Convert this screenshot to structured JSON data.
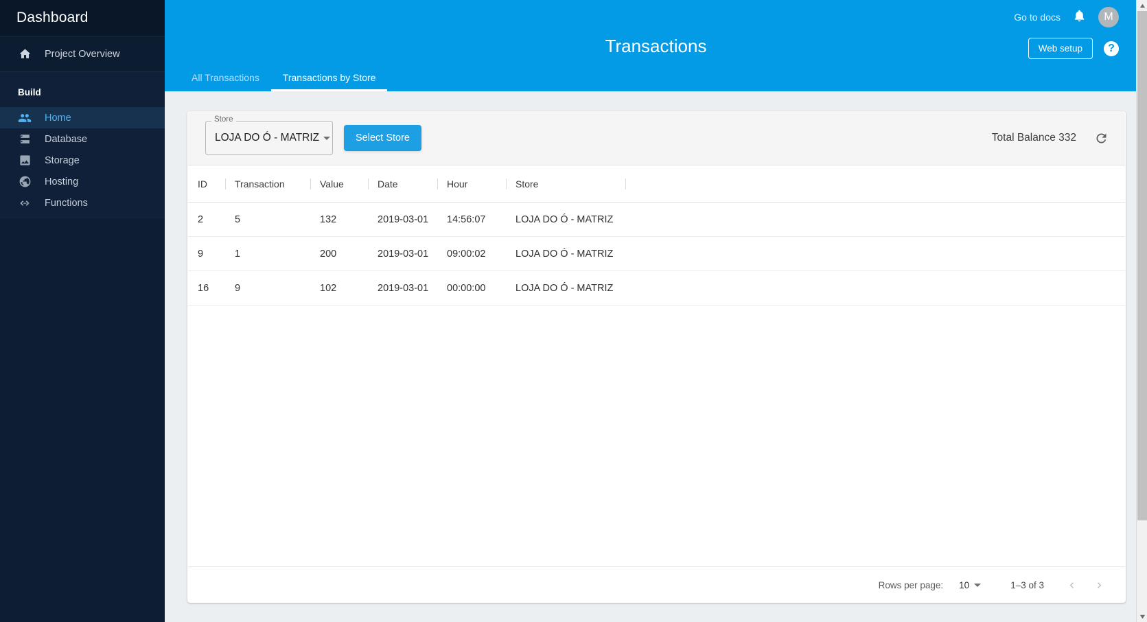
{
  "sidebar": {
    "brand": "Dashboard",
    "overview": {
      "label": "Project Overview",
      "icon": "home-icon"
    },
    "section": "Build",
    "items": [
      {
        "label": "Home",
        "icon": "people-icon",
        "active": true
      },
      {
        "label": "Database",
        "icon": "database-icon",
        "active": false
      },
      {
        "label": "Storage",
        "icon": "image-icon",
        "active": false
      },
      {
        "label": "Hosting",
        "icon": "globe-icon",
        "active": false
      },
      {
        "label": "Functions",
        "icon": "code-icon",
        "active": false
      }
    ]
  },
  "topbar": {
    "title": "Transactions",
    "go_to_docs": "Go to docs",
    "bell_icon": "bell-icon",
    "avatar_initial": "M",
    "web_setup": "Web setup",
    "help_icon": "help-icon",
    "accent_color": "#039be5",
    "tabs": [
      {
        "label": "All Transactions",
        "active": false
      },
      {
        "label": "Transactions by Store",
        "active": true
      }
    ]
  },
  "toolbar": {
    "store_label": "Store",
    "store_value": "LOJA DO Ó - MATRIZ",
    "select_store_button": "Select Store",
    "total_balance": "Total Balance 332",
    "refresh_icon": "refresh-icon"
  },
  "table": {
    "columns": [
      "ID",
      "Transaction",
      "Value",
      "Date",
      "Hour",
      "Store",
      ""
    ],
    "rows": [
      {
        "id": "2",
        "transaction": "5",
        "value": "132",
        "date": "2019-03-01",
        "hour": "14:56:07",
        "store": "LOJA DO Ó - MATRIZ"
      },
      {
        "id": "9",
        "transaction": "1",
        "value": "200",
        "date": "2019-03-01",
        "hour": "09:00:02",
        "store": "LOJA DO Ó - MATRIZ"
      },
      {
        "id": "16",
        "transaction": "9",
        "value": "102",
        "date": "2019-03-01",
        "hour": "00:00:00",
        "store": "LOJA DO Ó - MATRIZ"
      }
    ]
  },
  "pagination": {
    "rows_per_page_label": "Rows per page:",
    "rows_per_page_value": "10",
    "range": "1–3 of 3",
    "prev_icon": "chevron-left-icon",
    "next_icon": "chevron-right-icon"
  }
}
